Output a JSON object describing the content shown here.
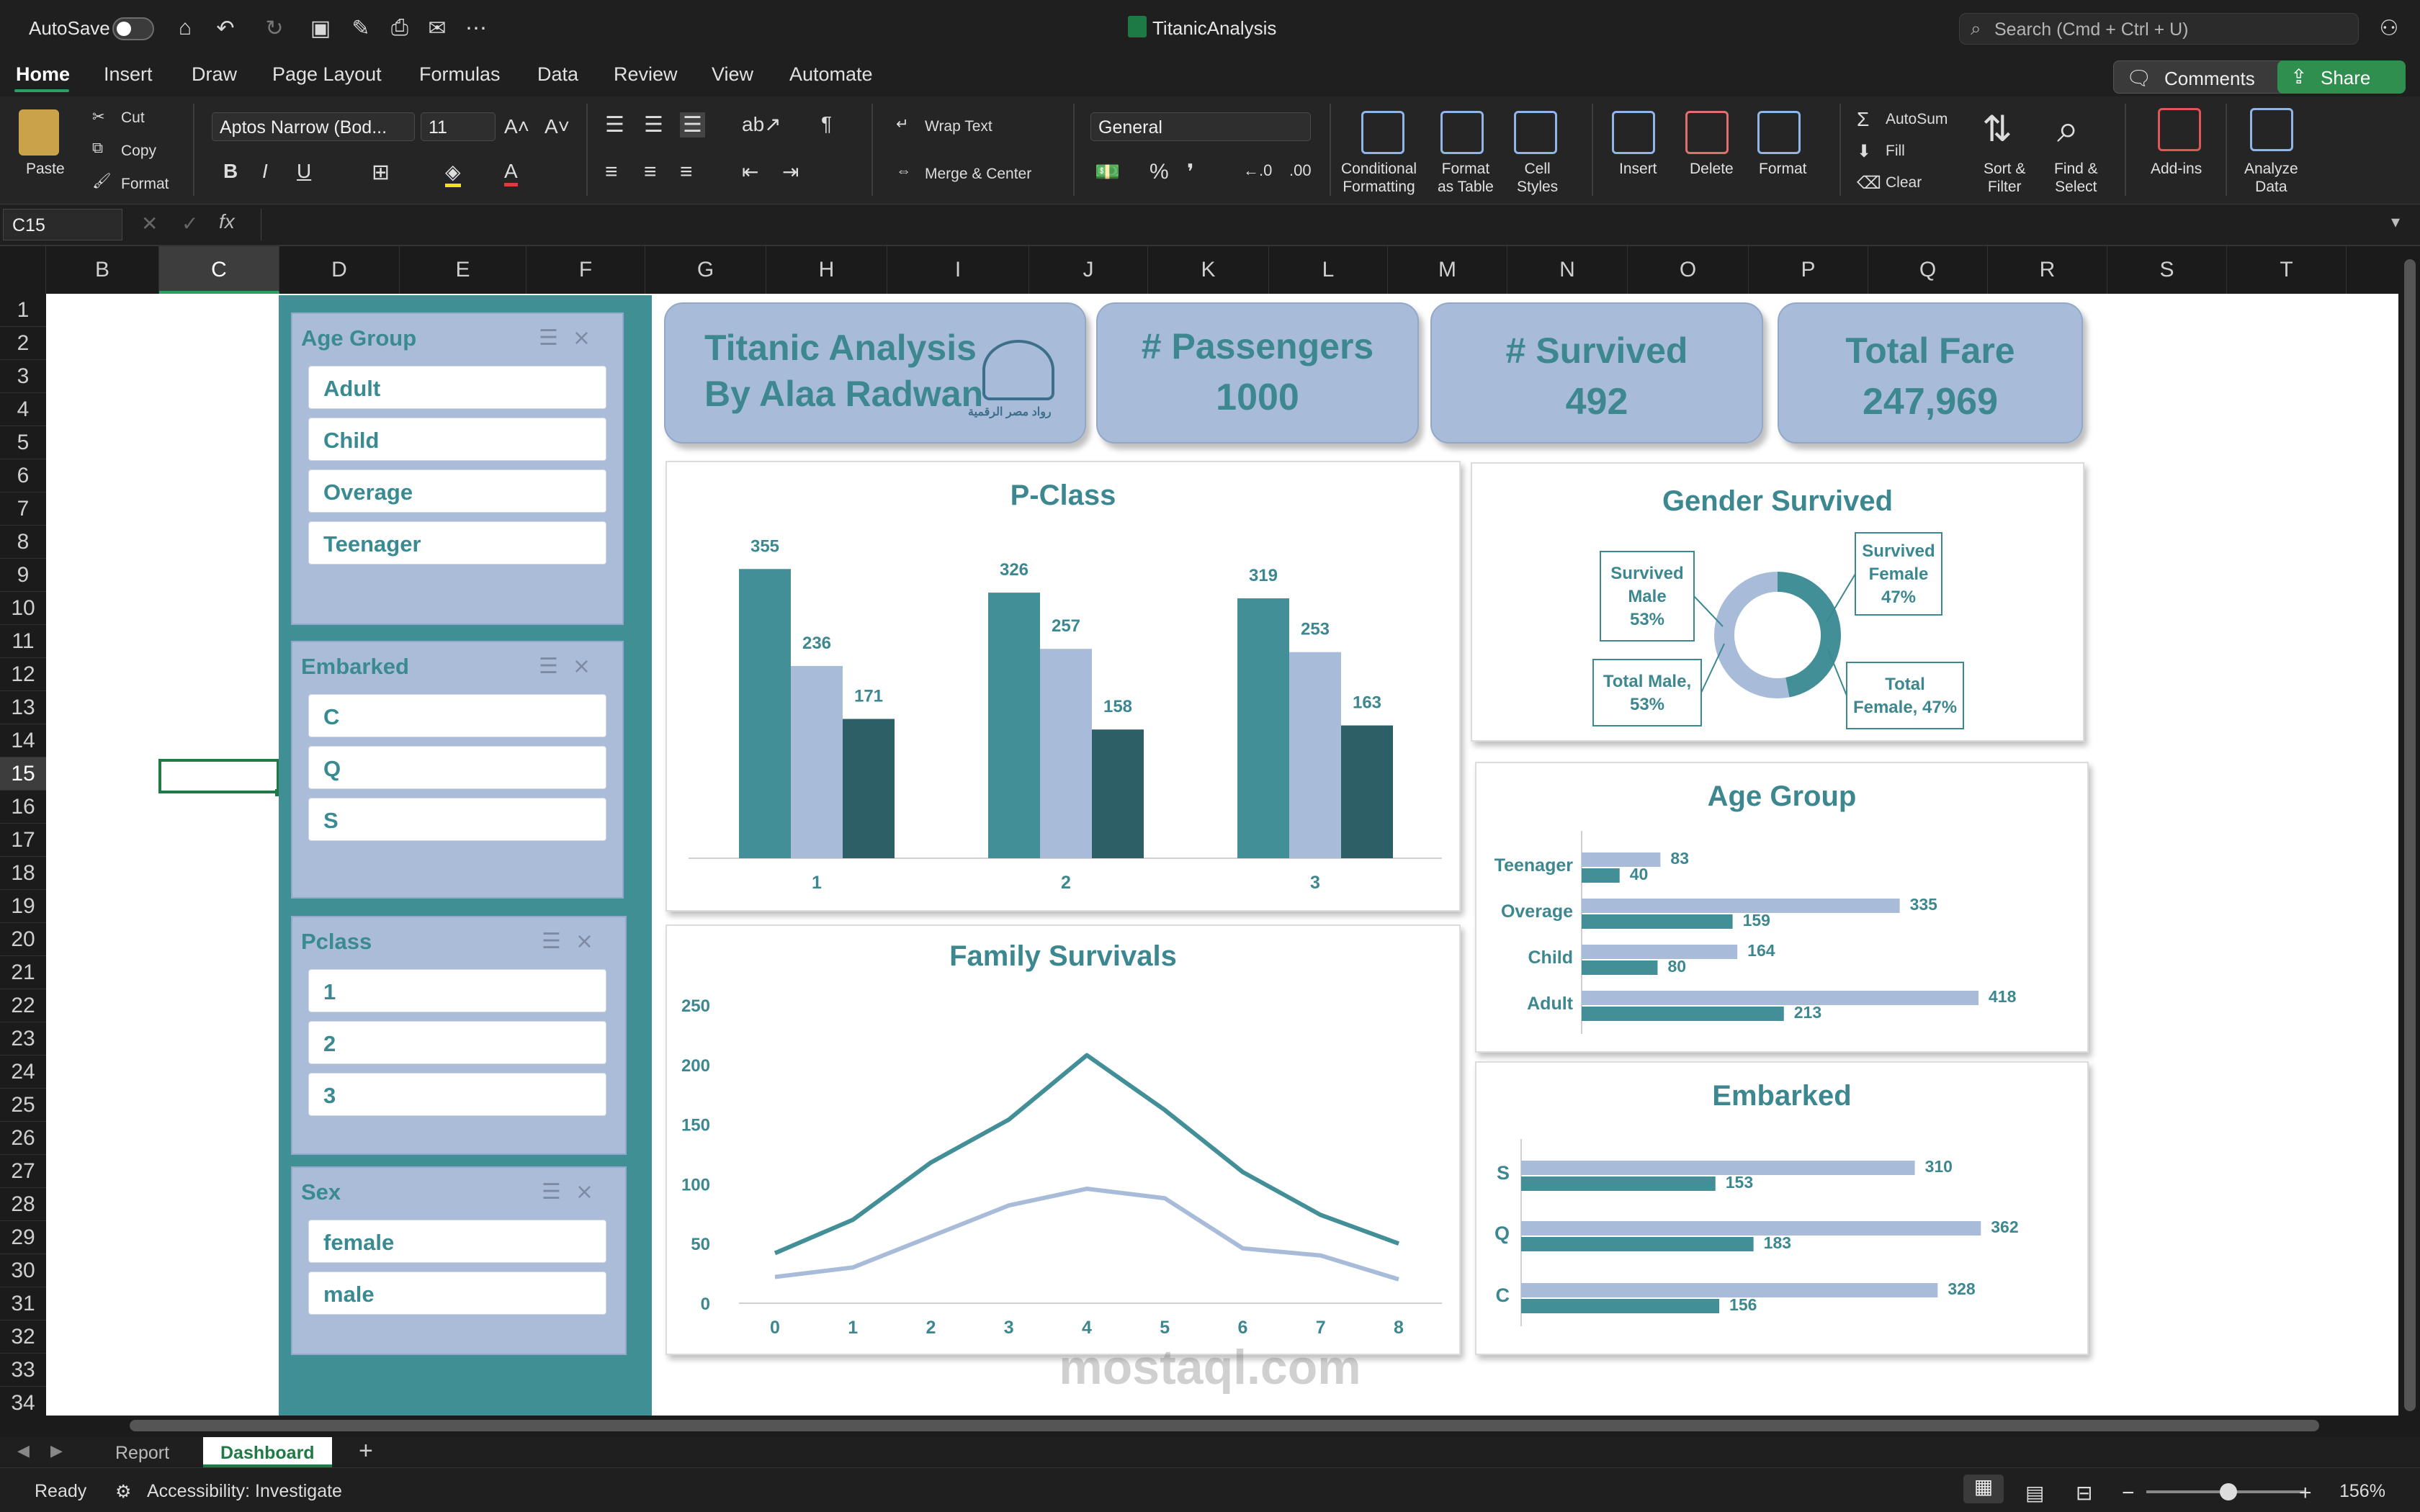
{
  "window": {
    "title": "TitanicAnalysis",
    "autosave": "AutoSave",
    "search_placeholder": "Search (Cmd + Ctrl + U)"
  },
  "menu": {
    "items": [
      "Home",
      "Insert",
      "Draw",
      "Page Layout",
      "Formulas",
      "Data",
      "Review",
      "View",
      "Automate"
    ],
    "comments": "Comments",
    "share": "Share"
  },
  "ribbon": {
    "paste": "Paste",
    "cut": "Cut",
    "copy": "Copy",
    "format": "Format",
    "font_name": "Aptos Narrow (Bod...",
    "font_size": "11",
    "wrap_text": "Wrap Text",
    "merge_center": "Merge & Center",
    "number_format": "General",
    "conditional_formatting": "Conditional\nFormatting",
    "format_as_table": "Format\nas Table",
    "cell_styles": "Cell\nStyles",
    "insert": "Insert",
    "delete": "Delete",
    "format_cells": "Format",
    "autosum": "AutoSum",
    "fill": "Fill",
    "clear": "Clear",
    "sort_filter": "Sort &\nFilter",
    "find_select": "Find &\nSelect",
    "add_ins": "Add-ins",
    "analyze_data": "Analyze\nData"
  },
  "formula_bar": {
    "name_box": "C15",
    "fx": "fx",
    "content": ""
  },
  "columns": [
    "B",
    "C",
    "D",
    "E",
    "F",
    "G",
    "H",
    "I",
    "J",
    "K",
    "L",
    "M",
    "N",
    "O",
    "P",
    "Q",
    "R",
    "S",
    "T"
  ],
  "selected_column": "C",
  "rows": [
    "1",
    "2",
    "3",
    "4",
    "5",
    "6",
    "7",
    "8",
    "9",
    "10",
    "11",
    "12",
    "13",
    "14",
    "15",
    "16",
    "17",
    "18",
    "19",
    "20",
    "21",
    "22",
    "23",
    "24",
    "25",
    "26",
    "27",
    "28",
    "29",
    "30",
    "31",
    "32",
    "33",
    "34"
  ],
  "selected_row": "15",
  "slicers": [
    {
      "title": "Age Group",
      "items": [
        "Adult",
        "Child",
        "Overage",
        "Teenager"
      ]
    },
    {
      "title": "Embarked",
      "items": [
        "C",
        "Q",
        "S"
      ]
    },
    {
      "title": "Pclass",
      "items": [
        "1",
        "2",
        "3"
      ]
    },
    {
      "title": "Sex",
      "items": [
        "female",
        "male"
      ]
    }
  ],
  "kpis": {
    "title_line1": "Titanic Analysis",
    "title_line2": "By Alaa Radwan",
    "logo_caption": "رواد مصر الرقمية",
    "passengers_label": "# Passengers",
    "passengers_value": "1000",
    "survived_label": "# Survived",
    "survived_value": "492",
    "fare_label": "Total Fare",
    "fare_value": "247,969"
  },
  "chart_data": [
    {
      "type": "bar",
      "title": "P-Class",
      "categories": [
        "1",
        "2",
        "3"
      ],
      "series": [
        {
          "values": [
            355,
            326,
            319
          ]
        },
        {
          "values": [
            236,
            257,
            253
          ]
        },
        {
          "values": [
            171,
            158,
            163
          ]
        }
      ],
      "colors": [
        "#438f98",
        "#a8bcda",
        "#2c5f66"
      ],
      "ylim": [
        0,
        380
      ]
    },
    {
      "type": "line",
      "title": "Family  Survivals",
      "x": [
        0,
        1,
        2,
        3,
        4,
        5,
        6,
        7,
        8
      ],
      "series": [
        {
          "values": [
            42,
            70,
            118,
            154,
            208,
            162,
            110,
            74,
            50
          ]
        },
        {
          "values": [
            22,
            30,
            56,
            82,
            96,
            88,
            46,
            40,
            20
          ]
        }
      ],
      "colors": [
        "#438f98",
        "#a8bcda"
      ],
      "yticks": [
        "0",
        "50",
        "100",
        "150",
        "200",
        "250"
      ],
      "ylim": [
        0,
        250
      ]
    },
    {
      "type": "pie",
      "title": "Gender Survived",
      "slices": [
        {
          "label": "Survived Male",
          "value": 53
        },
        {
          "label": "Survived Female",
          "value": 47
        }
      ],
      "labels": [
        "Survived\nMale\n53%",
        "Survived\nFemale\n47%",
        "Total Male,\n53%",
        "Total\nFemale, 47%"
      ],
      "colors": [
        "#a8bcda",
        "#438f98"
      ]
    },
    {
      "type": "bar",
      "title": "Age Group",
      "categories": [
        "Teenager",
        "Overage",
        "Child",
        "Adult"
      ],
      "series": [
        {
          "values": [
            83,
            335,
            164,
            418
          ]
        },
        {
          "values": [
            40,
            159,
            80,
            213
          ]
        }
      ],
      "colors": [
        "#a8bcda",
        "#438f98"
      ],
      "xlim": [
        0,
        440
      ]
    },
    {
      "type": "bar",
      "title": "Embarked",
      "categories": [
        "S",
        "Q",
        "C"
      ],
      "series": [
        {
          "values": [
            310,
            362,
            328
          ]
        },
        {
          "values": [
            153,
            183,
            156
          ]
        }
      ],
      "colors": [
        "#a8bcda",
        "#438f98"
      ],
      "xlim": [
        0,
        380
      ]
    }
  ],
  "sheet_tabs": [
    "Report",
    "Dashboard"
  ],
  "active_tab": "Dashboard",
  "status": {
    "ready": "Ready",
    "accessibility": "Accessibility: Investigate",
    "zoom": "156%"
  },
  "watermark": "mostaql.com"
}
